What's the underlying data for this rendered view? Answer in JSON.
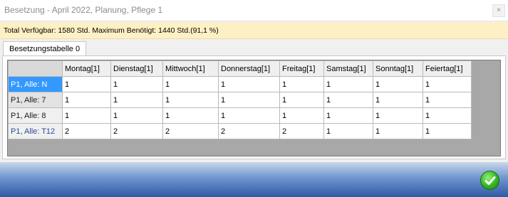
{
  "window": {
    "title": "Besetzung - April 2022, Planung, Pflege 1",
    "close_glyph": "×"
  },
  "info": {
    "text": "Total Verfügbar: 1580 Std.  Maximum Benötigt: 1440 Std.(91,1 %)"
  },
  "tabs": [
    {
      "label": "Besetzungstabelle 0",
      "active": true
    }
  ],
  "table": {
    "columns": [
      "Montag[1]",
      "Dienstag[1]",
      "Mittwoch[1]",
      "Donnerstag[1]",
      "Freitag[1]",
      "Samstag[1]",
      "Sonntag[1]",
      "Feiertag[1]"
    ],
    "rows": [
      {
        "label": "P1, Alle: N",
        "values": [
          "1",
          "1",
          "1",
          "1",
          "1",
          "1",
          "1",
          "1"
        ]
      },
      {
        "label": "P1, Alle: 7",
        "values": [
          "1",
          "1",
          "1",
          "1",
          "1",
          "1",
          "1",
          "1"
        ]
      },
      {
        "label": "P1, Alle: 8",
        "values": [
          "1",
          "1",
          "1",
          "1",
          "1",
          "1",
          "1",
          "1"
        ]
      },
      {
        "label": "P1, Alle: T12",
        "values": [
          "2",
          "2",
          "2",
          "2",
          "2",
          "1",
          "1",
          "1"
        ]
      }
    ]
  },
  "footer": {
    "ok_icon": "green-checkmark"
  }
}
